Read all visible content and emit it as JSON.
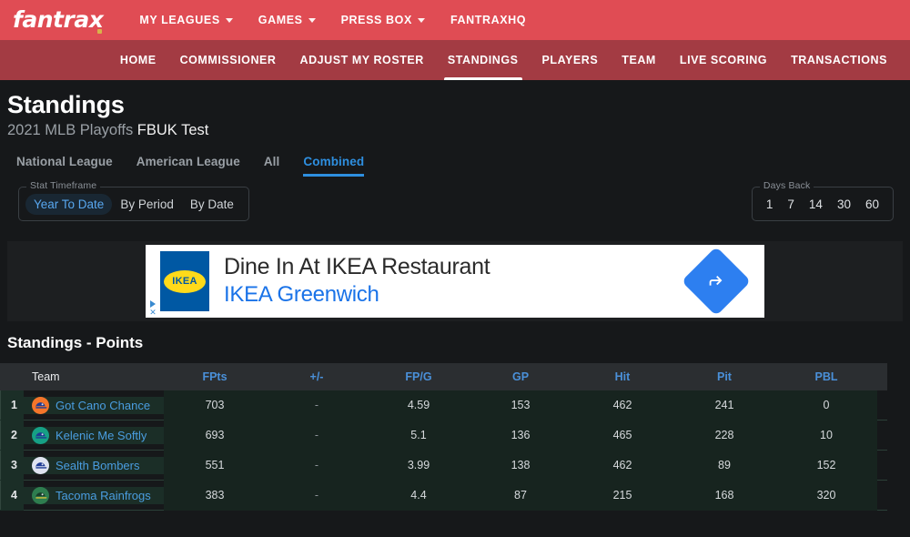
{
  "topbar": {
    "logo": "fantrax",
    "nav": [
      {
        "label": "MY LEAGUES",
        "caret": true
      },
      {
        "label": "GAMES",
        "caret": true
      },
      {
        "label": "PRESS BOX",
        "caret": true
      },
      {
        "label": "FANTRAXHQ",
        "caret": false
      }
    ]
  },
  "subnav": {
    "items": [
      {
        "label": "HOME",
        "active": false
      },
      {
        "label": "COMMISSIONER",
        "active": false
      },
      {
        "label": "ADJUST MY ROSTER",
        "active": false
      },
      {
        "label": "STANDINGS",
        "active": true
      },
      {
        "label": "PLAYERS",
        "active": false
      },
      {
        "label": "TEAM",
        "active": false
      },
      {
        "label": "LIVE SCORING",
        "active": false
      },
      {
        "label": "TRANSACTIONS",
        "active": false
      }
    ]
  },
  "header": {
    "title": "Standings",
    "subtitle_season": "2021 MLB Playoffs",
    "subtitle_league": "FBUK Test"
  },
  "league_tabs": [
    {
      "label": "National League",
      "active": false
    },
    {
      "label": "American League",
      "active": false
    },
    {
      "label": "All",
      "active": false
    },
    {
      "label": "Combined",
      "active": true
    }
  ],
  "filters": {
    "stat_timeframe": {
      "legend": "Stat Timeframe",
      "options": [
        "Year To Date",
        "By Period",
        "By Date"
      ],
      "selected": "Year To Date"
    },
    "days_back": {
      "legend": "Days Back",
      "options": [
        "1",
        "7",
        "14",
        "30",
        "60"
      ],
      "selected": ""
    }
  },
  "ad": {
    "brand": "IKEA",
    "headline": "Dine In At IKEA Restaurant",
    "sponsor": "IKEA Greenwich",
    "cta_icon": "directions-arrow-icon",
    "adchoices_icon": "adchoices-triangle-icon",
    "close_icon": "close-x-icon"
  },
  "standings": {
    "section_title": "Standings - Points",
    "columns": [
      "Team",
      "FPts",
      "+/-",
      "FP/G",
      "GP",
      "Hit",
      "Pit",
      "PBL"
    ],
    "rows": [
      {
        "rank": "1",
        "team": "Got Cano Chance",
        "avatar": {
          "ring": "#f4752a",
          "cap": "#1f3a93",
          "brim": "#1f3a93"
        },
        "fpts": "703",
        "plusminus": "-",
        "fpg": "4.59",
        "gp": "153",
        "hit": "462",
        "pit": "241",
        "pbl": "0"
      },
      {
        "rank": "2",
        "team": "Kelenic Me Softly",
        "avatar": {
          "ring": "#16a085",
          "cap": "#1f3a93",
          "brim": "#1f3a93"
        },
        "fpts": "693",
        "plusminus": "-",
        "fpg": "5.1",
        "gp": "136",
        "hit": "465",
        "pit": "228",
        "pbl": "10"
      },
      {
        "rank": "3",
        "team": "Sealth Bombers",
        "avatar": {
          "ring": "#dfe3f0",
          "cap": "#1f3a93",
          "brim": "#1f3a93"
        },
        "fpts": "551",
        "plusminus": "-",
        "fpg": "3.99",
        "gp": "138",
        "hit": "462",
        "pit": "89",
        "pbl": "152"
      },
      {
        "rank": "4",
        "team": "Tacoma Rainfrogs",
        "avatar": {
          "ring": "#2e7d4f",
          "cap": "#173d2a",
          "brim": "#d4c23a"
        },
        "fpts": "383",
        "plusminus": "-",
        "fpg": "4.4",
        "gp": "87",
        "hit": "215",
        "pit": "168",
        "pbl": "320"
      }
    ]
  },
  "colors": {
    "brand_red": "#e04c54",
    "subnav_red": "#a33b43",
    "accent_blue": "#2e8fe0",
    "page_bg": "#16181a",
    "row_green": "#1b2e27"
  }
}
